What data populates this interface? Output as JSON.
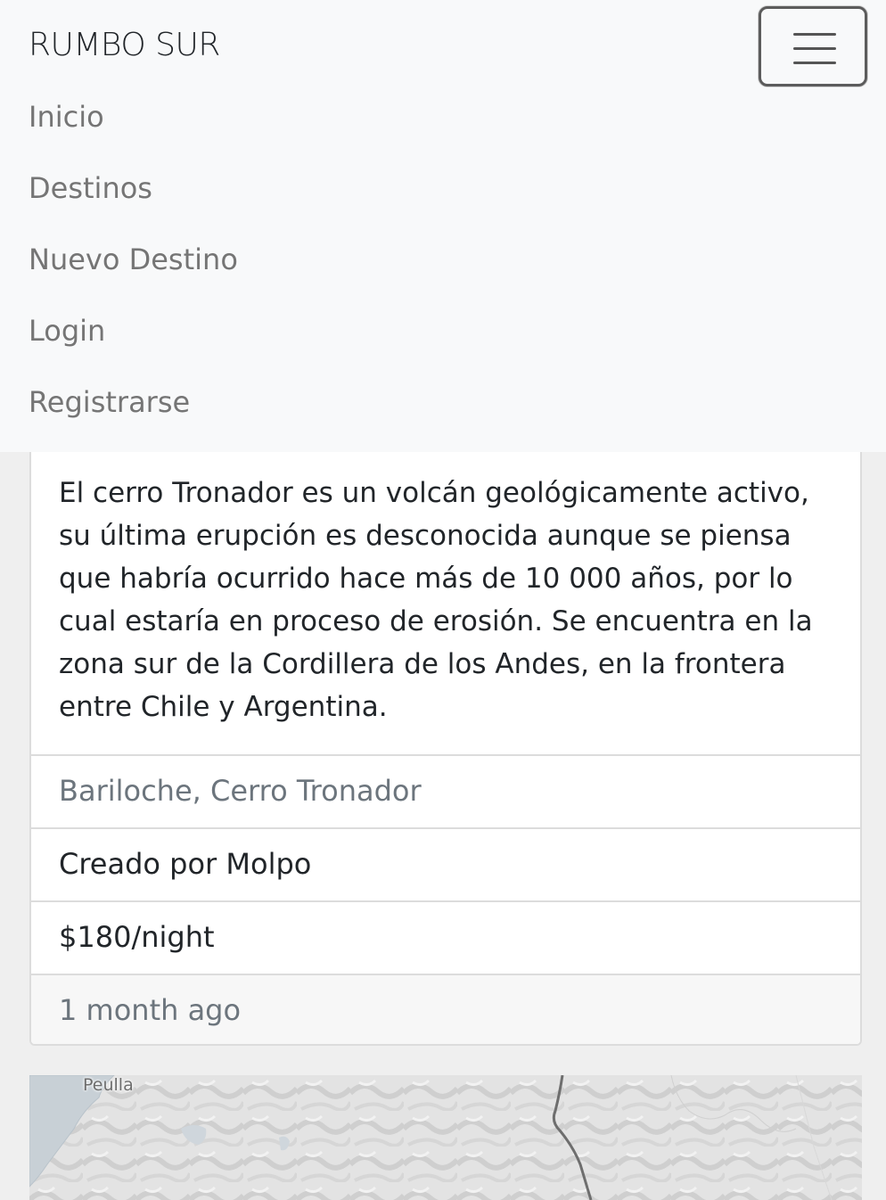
{
  "navbar": {
    "brand": "RUMBO SUR",
    "toggler_icon": "hamburger-icon",
    "links": [
      "Inicio",
      "Destinos",
      "Nuevo Destino",
      "Login",
      "Registrarse"
    ]
  },
  "card": {
    "description": "El cerro Tronador es un volcán geológicamente activo, su última erupción es desconocida aunque se piensa que habría ocurrido hace más de 10 000 años, por lo cual estaría en proceso de erosión. Se encuentra en la zona sur de la Cordillera de los Andes, en la frontera entre Chile y Argentina.",
    "location": "Bariloche, Cerro Tronador",
    "author": "Creado por Molpo",
    "price": "$180/night",
    "footer": "1 month ago"
  },
  "map": {
    "place_label": "Peulla"
  }
}
